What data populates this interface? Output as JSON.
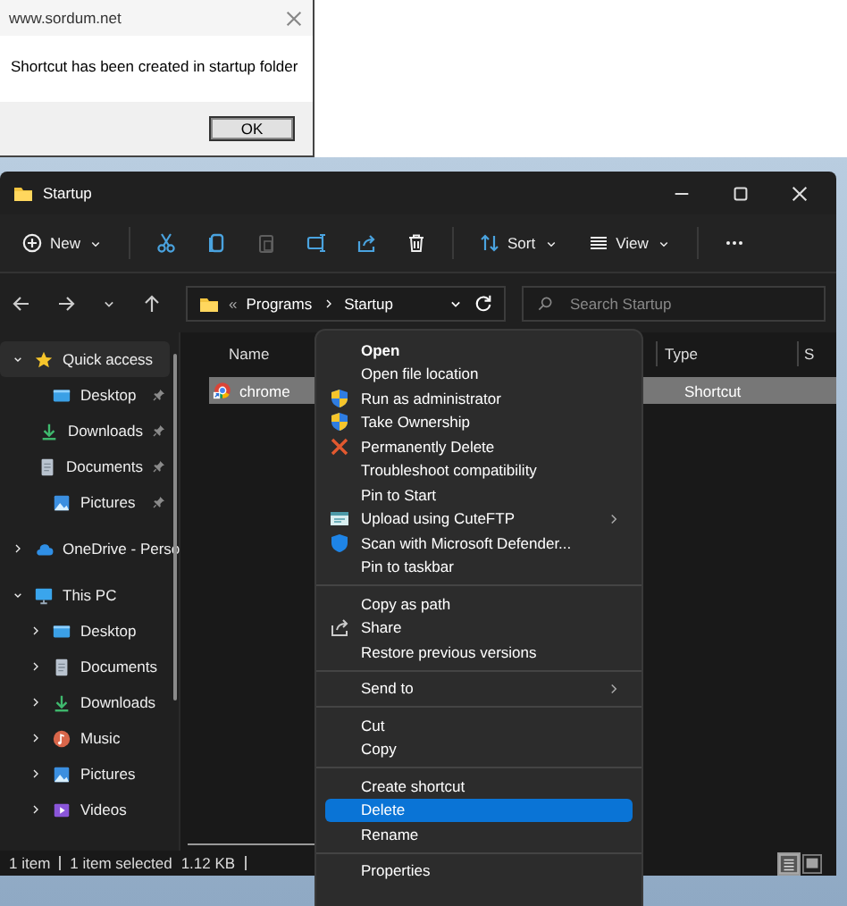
{
  "message_box": {
    "title": "www.sordum.net",
    "message": "Shortcut has been created in startup folder",
    "button": "OK"
  },
  "explorer": {
    "title": "Startup",
    "toolbar": [
      {
        "kind": "new",
        "label": "New",
        "disabled": false
      },
      {
        "kind": "cut",
        "disabled": false
      },
      {
        "kind": "copy",
        "disabled": false
      },
      {
        "kind": "paste",
        "disabled": true
      },
      {
        "kind": "rename",
        "disabled": false
      },
      {
        "kind": "share",
        "disabled": false
      },
      {
        "kind": "delete",
        "disabled": false
      },
      {
        "kind": "sort",
        "label": "Sort",
        "disabled": false
      },
      {
        "kind": "view",
        "label": "View",
        "disabled": false
      },
      {
        "kind": "more",
        "disabled": false
      }
    ],
    "address": {
      "overflow": "«",
      "crumbs": [
        "Programs",
        "Startup"
      ]
    },
    "search": {
      "placeholder": "Search Startup"
    },
    "nav": [
      {
        "label": "Quick access",
        "expanded": true,
        "selected": true,
        "children": [
          {
            "label": "Desktop",
            "pinned": true,
            "selected": false
          },
          {
            "label": "Downloads",
            "pinned": true,
            "selected": false
          },
          {
            "label": "Documents",
            "pinned": true,
            "selected": false
          },
          {
            "label": "Pictures",
            "pinned": true,
            "selected": false
          }
        ]
      },
      {
        "label": "OneDrive - Perso",
        "expanded": false,
        "selected": false
      },
      {
        "label": "This PC",
        "expanded": true,
        "selected": false,
        "children": [
          {
            "label": "Desktop",
            "expanded": false,
            "selected": false
          },
          {
            "label": "Documents",
            "expanded": false,
            "selected": false
          },
          {
            "label": "Downloads",
            "expanded": false,
            "selected": false
          },
          {
            "label": "Music",
            "expanded": false,
            "selected": false
          },
          {
            "label": "Pictures",
            "expanded": false,
            "selected": false
          },
          {
            "label": "Videos",
            "expanded": false,
            "selected": false
          }
        ]
      }
    ],
    "columns": [
      "Name",
      "Type",
      "S"
    ],
    "files": [
      {
        "name": "chrome",
        "type": "Shortcut",
        "selected": true
      }
    ],
    "status": {
      "count": "1 item",
      "selection": "1 item selected",
      "size": "1.12 KB"
    },
    "view_modes": [
      {
        "kind": "details",
        "selected": true
      },
      {
        "kind": "tiles",
        "selected": false
      }
    ]
  },
  "context_menu": [
    {
      "kind": "item",
      "label": "Open",
      "default": true,
      "submenu": false,
      "selected": false
    },
    {
      "kind": "item",
      "label": "Open file location",
      "default": false,
      "submenu": false,
      "selected": false
    },
    {
      "kind": "item",
      "label": "Run as administrator",
      "default": false,
      "submenu": false,
      "selected": false
    },
    {
      "kind": "item",
      "label": "Take Ownership",
      "default": false,
      "submenu": false,
      "selected": false
    },
    {
      "kind": "item",
      "label": "Permanently Delete",
      "default": false,
      "submenu": false,
      "selected": false
    },
    {
      "kind": "item",
      "label": "Troubleshoot compatibility",
      "default": false,
      "submenu": false,
      "selected": false
    },
    {
      "kind": "item",
      "label": "Pin to Start",
      "default": false,
      "submenu": false,
      "selected": false
    },
    {
      "kind": "item",
      "label": "Upload using CuteFTP",
      "default": false,
      "submenu": true,
      "selected": false
    },
    {
      "kind": "item",
      "label": "Scan with Microsoft Defender...",
      "default": false,
      "submenu": false,
      "selected": false
    },
    {
      "kind": "item",
      "label": "Pin to taskbar",
      "default": false,
      "submenu": false,
      "selected": false
    },
    {
      "kind": "separator"
    },
    {
      "kind": "item",
      "label": "Copy as path",
      "default": false,
      "submenu": false,
      "selected": false
    },
    {
      "kind": "item",
      "label": "Share",
      "default": false,
      "submenu": false,
      "selected": false
    },
    {
      "kind": "item",
      "label": "Restore previous versions",
      "default": false,
      "submenu": false,
      "selected": false
    },
    {
      "kind": "separator"
    },
    {
      "kind": "item",
      "label": "Send to",
      "default": false,
      "submenu": true,
      "selected": false
    },
    {
      "kind": "separator"
    },
    {
      "kind": "item",
      "label": "Cut",
      "default": false,
      "submenu": false,
      "selected": false
    },
    {
      "kind": "item",
      "label": "Copy",
      "default": false,
      "submenu": false,
      "selected": false
    },
    {
      "kind": "separator"
    },
    {
      "kind": "item",
      "label": "Create shortcut",
      "default": false,
      "submenu": false,
      "selected": false
    },
    {
      "kind": "item",
      "label": "Delete",
      "default": false,
      "submenu": false,
      "selected": true
    },
    {
      "kind": "item",
      "label": "Rename",
      "default": false,
      "submenu": false,
      "selected": false
    },
    {
      "kind": "separator"
    },
    {
      "kind": "item",
      "label": "Properties",
      "default": false,
      "submenu": false,
      "selected": false
    }
  ]
}
